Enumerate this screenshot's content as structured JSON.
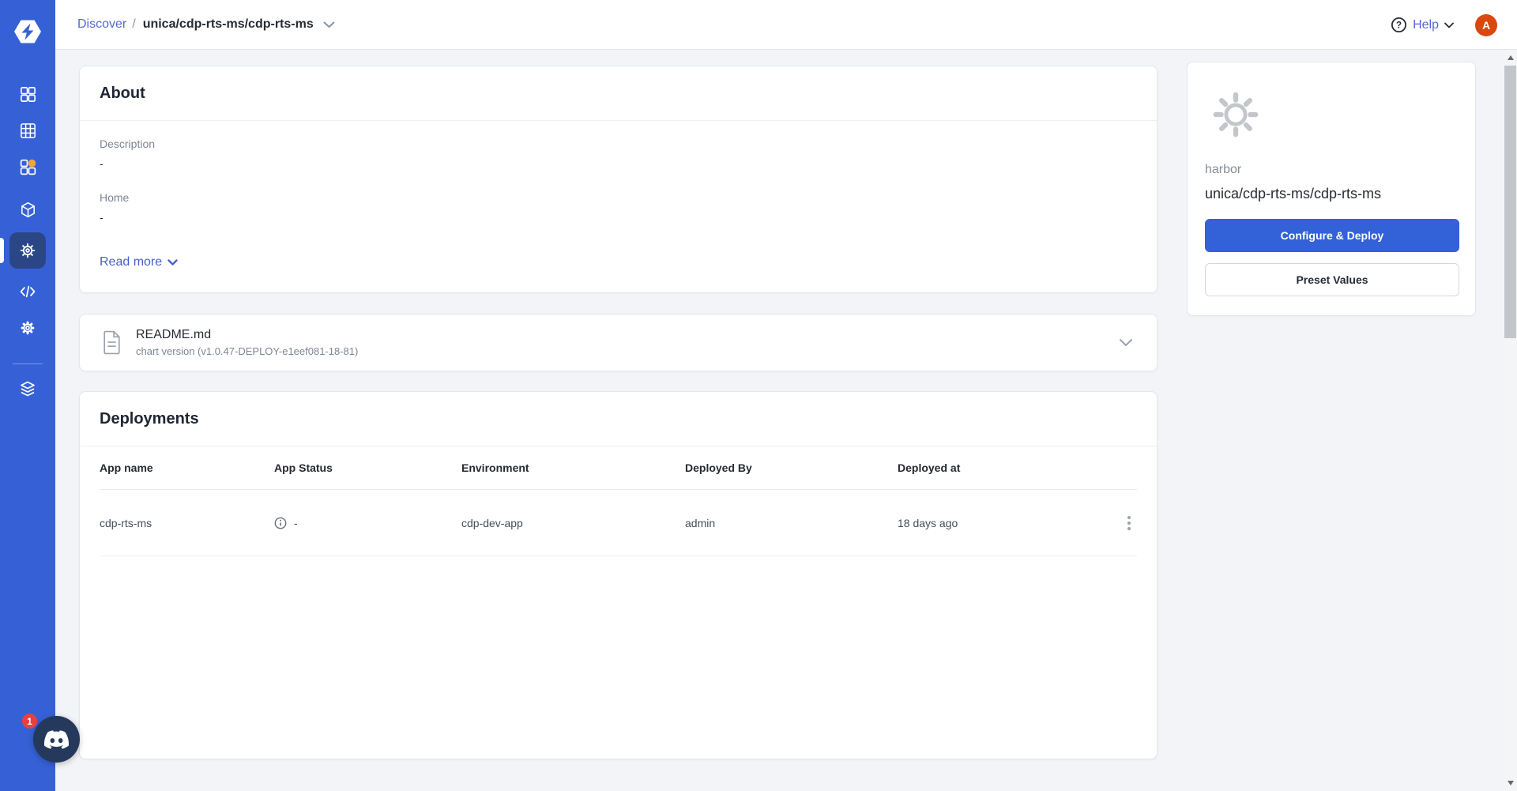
{
  "header": {
    "breadcrumb": {
      "section": "Discover",
      "separator": "/",
      "chart": "unica/cdp-rts-ms/cdp-rts-ms"
    },
    "help": {
      "label": "Help",
      "icon_glyph": "?"
    },
    "avatar": {
      "initial": "A"
    }
  },
  "sidebar": {
    "items": [
      {
        "icon": "apps-grid-icon",
        "active": false
      },
      {
        "icon": "jobs-grid-icon",
        "active": false
      },
      {
        "icon": "app-groups-icon",
        "active": false,
        "has_notification_dot": true
      },
      {
        "icon": "cube-icon",
        "active": false
      },
      {
        "icon": "helm-wheel-icon",
        "active": true
      },
      {
        "icon": "code-icon",
        "active": false
      },
      {
        "icon": "gear-icon",
        "active": false
      },
      {
        "icon": "stack-icon",
        "active": false
      }
    ]
  },
  "about": {
    "title": "About",
    "fields": [
      {
        "label": "Description",
        "value": "-"
      },
      {
        "label": "Home",
        "value": "-"
      }
    ],
    "read_more_label": "Read more"
  },
  "readme": {
    "filename": "README.md",
    "version_note": "chart version (v1.0.47-DEPLOY-e1eef081-18-81)"
  },
  "deployments": {
    "title": "Deployments",
    "columns": [
      "App name",
      "App Status",
      "Environment",
      "Deployed By",
      "Deployed at"
    ],
    "rows": [
      {
        "app_name": "cdp-rts-ms",
        "app_status": "-",
        "environment": "cdp-dev-app",
        "deployed_by": "admin",
        "deployed_at": "18 days ago"
      }
    ]
  },
  "chart_summary": {
    "repo": "harbor",
    "chart_name": "unica/cdp-rts-ms/cdp-rts-ms",
    "primary_button_label": "Configure & Deploy",
    "secondary_button_label": "Preset Values"
  },
  "discord_widget": {
    "badge_count": "1"
  },
  "colors": {
    "sidebar_blue": "#3661d6",
    "active_nav_bg": "#2b4687",
    "primary_button_blue": "#3361d8",
    "link_blue": "#5569d6",
    "avatar_orange": "#d9480f",
    "notification_orange": "#f0a63c",
    "badge_red": "#e8403f",
    "discord_navy": "#24395c",
    "page_background": "#f2f4f7"
  }
}
